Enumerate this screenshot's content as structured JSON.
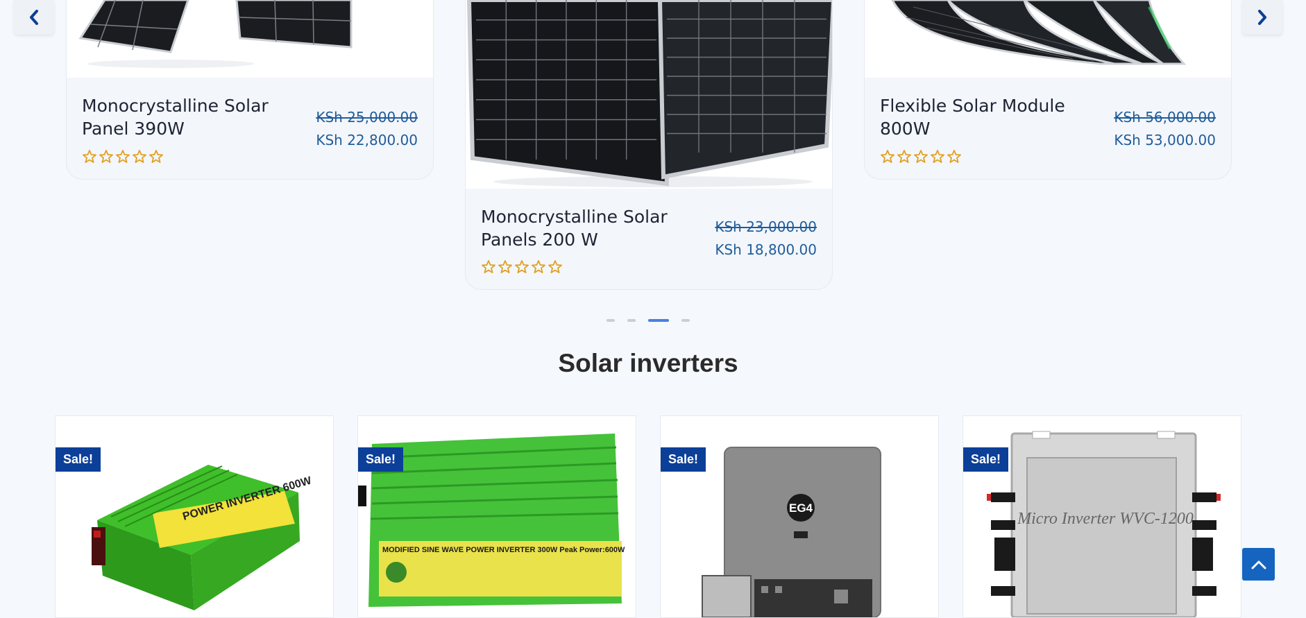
{
  "colors": {
    "accent": "#1565c0",
    "sale_badge": "#0c3f98",
    "price": "#1f5c99",
    "star": "#e0a01f",
    "dot_active": "#4a7fe0",
    "dot_inactive": "#c9ced8"
  },
  "carousel": {
    "prev_icon": "chevron-left-icon",
    "next_icon": "chevron-right-icon",
    "products": [
      {
        "title": "Monocrystalline Solar Panel 390W",
        "old_price": "KSh 25,000.00",
        "price": "KSh 22,800.00",
        "rating": 0
      },
      {
        "title": "Monocrystalline Solar Panels 200 W",
        "old_price": "KSh 23,000.00",
        "price": "KSh 18,800.00",
        "rating": 0
      },
      {
        "title": "Flexible Solar Module 800W",
        "old_price": "KSh 56,000.00",
        "price": "KSh 53,000.00",
        "rating": 0
      }
    ],
    "pagination": {
      "total": 4,
      "active": 3
    }
  },
  "inverters": {
    "title": "Solar inverters",
    "products": [
      {
        "badge": "Sale!",
        "image_text": "POWER INVERTER 600W"
      },
      {
        "badge": "Sale!",
        "image_text": "MODIFIED SINE WAVE POWER INVERTER 300W Peak Power:600W"
      },
      {
        "badge": "Sale!",
        "image_text": "EG4"
      },
      {
        "badge": "Sale!",
        "image_text": "Micro Inverter WVC-1200"
      }
    ]
  },
  "back_to_top_icon": "chevron-up-icon"
}
